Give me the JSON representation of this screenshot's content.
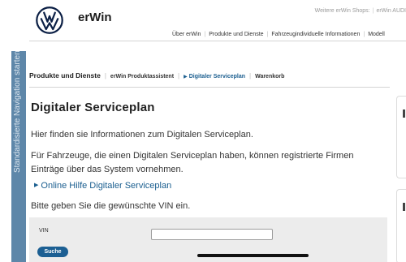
{
  "header": {
    "brand": "erWin",
    "shops_label": "Weitere erWin Shops:",
    "shop_link": "erWin AUDI",
    "nav": [
      "Über erWin",
      "Produkte und Dienste",
      "Fahrzeugindividuelle Informationen",
      "Modell"
    ]
  },
  "side_tab": {
    "label": "Standardisierte Navigation starten"
  },
  "breadcrumb": {
    "section": "Produkte und Dienste",
    "items": [
      "erWin Produktassistent",
      "Digitaler Serviceplan",
      "Warenkorb"
    ]
  },
  "main": {
    "title": "Digitaler Serviceplan",
    "intro": "Hier finden sie Informationen zum Digitalen Serviceplan.",
    "body": "Für Fahrzeuge, die einen Digitalen Serviceplan haben, können registrierte Firmen Einträge über das System vornehmen.",
    "help_link": "Online Hilfe Digitaler Serviceplan",
    "prompt": "Bitte geben Sie die gewünschte VIN ein."
  },
  "form": {
    "vin_label": "VIN",
    "vin_value": "",
    "search_label": "Suche"
  },
  "colors": {
    "accent": "#1a5e8f",
    "button": "#1c5f93",
    "side_tab": "#5e87a9"
  },
  "icons": {
    "logo": "vw-logo-icon",
    "link_marker": "triangle-right-icon"
  }
}
